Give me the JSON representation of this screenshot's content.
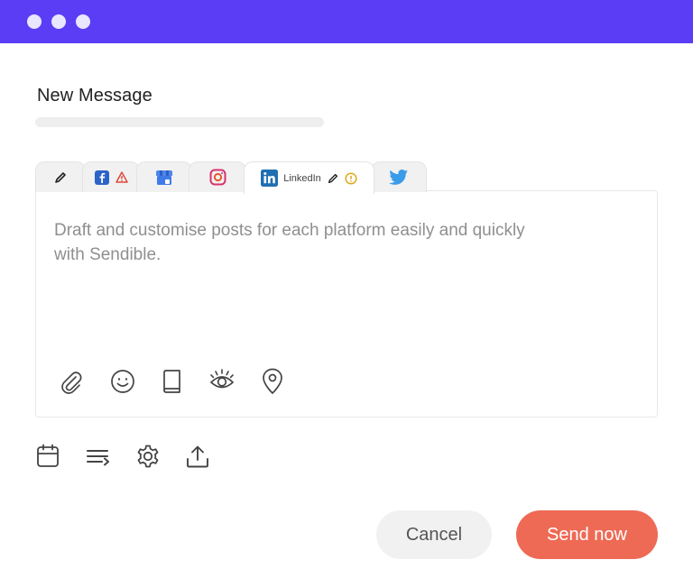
{
  "window": {
    "titlebar_color": "#5b3df5",
    "dots": [
      "window-dot",
      "window-dot",
      "window-dot"
    ]
  },
  "composer": {
    "title": "New Message",
    "tabs": [
      {
        "id": "all",
        "icon": "pencil-icon"
      },
      {
        "id": "facebook",
        "icon": "facebook-icon",
        "status_icon": "warning-triangle-icon"
      },
      {
        "id": "google-business",
        "icon": "google-business-icon"
      },
      {
        "id": "instagram",
        "icon": "instagram-icon"
      },
      {
        "id": "linkedin",
        "icon": "linkedin-icon",
        "label": "LinkedIn",
        "edit_icon": "pencil-icon",
        "status_icon": "info-circle-icon",
        "active": true
      },
      {
        "id": "twitter",
        "icon": "twitter-icon"
      }
    ],
    "placeholder": "Draft and customise posts for each platform easily and quickly with Sendible.",
    "editor_tools": [
      "paperclip-icon",
      "emoji-icon",
      "book-icon",
      "eye-icon",
      "location-pin-icon"
    ],
    "bottom_tools": [
      "calendar-icon",
      "queue-icon",
      "gear-icon",
      "upload-icon"
    ]
  },
  "actions": {
    "cancel_label": "Cancel",
    "send_label": "Send now"
  },
  "colors": {
    "accent": "#5b3df5",
    "send_button": "#ee6a55",
    "warning": "#e04a3c",
    "info": "#e0a91a",
    "linkedin": "#1f6fb2",
    "twitter": "#3a9be8",
    "facebook": "#2d63c8"
  }
}
